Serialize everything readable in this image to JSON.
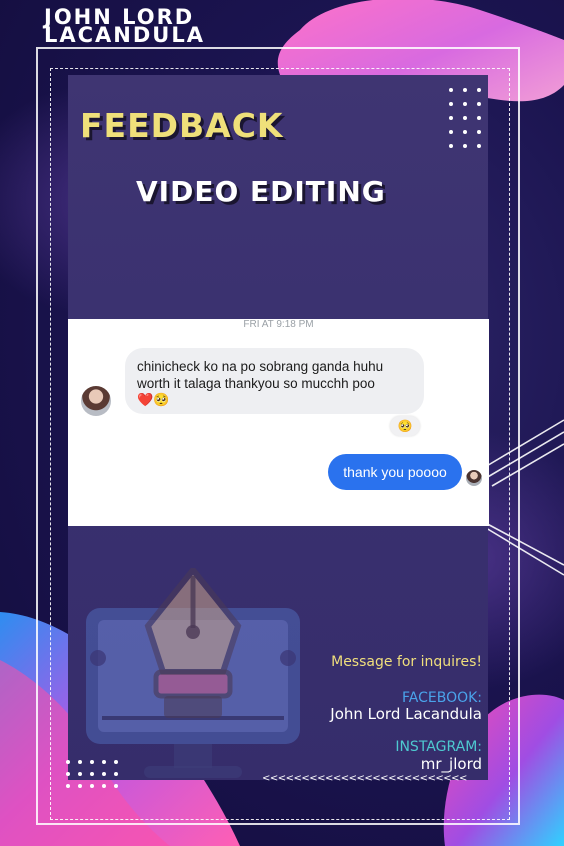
{
  "poster": {
    "name": "JOHN LORD LACANDULA",
    "title_feedback": "FEEDBACK",
    "title_video": "VIDEO EDITING"
  },
  "chat": {
    "timestamp": "FRI AT 9:18 PM",
    "incoming_message": "chinicheck ko na po sobrang ganda huhu worth it talaga thankyou so mucchh poo",
    "incoming_emojis": "❤️🥺",
    "reaction_emoji": "🥺",
    "outgoing_message": "thank you poooo"
  },
  "contact": {
    "message": "Message for inquires!",
    "facebook_label": "FACEBOOK:",
    "facebook_value": "John Lord Lacandula",
    "instagram_label": "INSTAGRAM:",
    "instagram_value": "mr_jlord",
    "arrows": "<<<<<<<<<<<<<<<<<<<<<<<<<<"
  },
  "icons": {
    "pen_monitor": "pen-tool-monitor-icon",
    "avatar": "profile-avatar"
  },
  "colors": {
    "background": "#1c1450",
    "panel": "#3a3170",
    "feedback_title": "#efe07a",
    "message_text": "#f0df7c",
    "facebook_label": "#4aa3ea",
    "instagram_label": "#4ec9d0",
    "messenger_blue": "#2a72ee"
  }
}
